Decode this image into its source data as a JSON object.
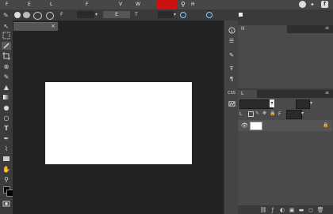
{
  "menubar": {
    "items": [
      "F",
      "E",
      "L",
      "F",
      "V",
      "W",
      "H"
    ],
    "share_icons": [
      "reddit-icon",
      "twitter-icon",
      "facebook-icon"
    ]
  },
  "options": {
    "label_f": "F",
    "label_e": "E",
    "label_t": "T",
    "color_swatch": "#cc1111",
    "select_label": ""
  },
  "document": {
    "tab_title": "",
    "close": "×"
  },
  "panels": {
    "history_tab": "H",
    "layers_tab": "L",
    "layers_label_l": "L",
    "layers_label_f": "F",
    "css_label": "CSS"
  },
  "colors": {
    "accent": "#cc1111",
    "canvas": "#ffffff",
    "bg": "#232323"
  }
}
